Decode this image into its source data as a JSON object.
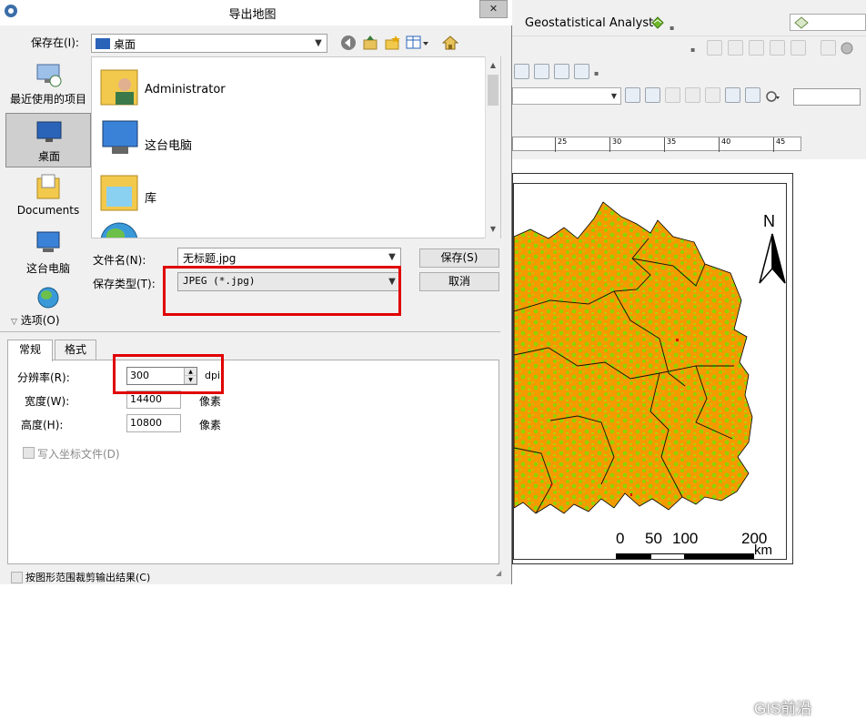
{
  "dialog": {
    "title": "导出地图",
    "close_glyph": "✕",
    "save_in_label": "保存在(I):",
    "save_in_value": "桌面",
    "places": [
      {
        "label": "最近使用的项目"
      },
      {
        "label": "桌面"
      },
      {
        "label": "Documents"
      },
      {
        "label": "这台电脑"
      }
    ],
    "files": [
      {
        "name": "Administrator"
      },
      {
        "name": "这台电脑"
      },
      {
        "name": "库"
      },
      {
        "name": "网络"
      }
    ],
    "filename_label": "文件名(N):",
    "filename_value": "无标题.jpg",
    "filetype_label": "保存类型(T):",
    "filetype_value": "JPEG (*.jpg)",
    "save_button": "保存(S)",
    "cancel_button": "取消",
    "options_label": "选项(O)",
    "tabs": [
      {
        "label": "常规"
      },
      {
        "label": "格式"
      }
    ],
    "resolution_label": "分辨率(R):",
    "resolution_value": "300",
    "resolution_unit": "dpi",
    "width_label": "宽度(W):",
    "width_value": "14400",
    "width_unit": "像素",
    "height_label": "高度(H):",
    "height_value": "10800",
    "height_unit": "像素",
    "world_file_label": "写入坐标文件(D)",
    "clip_label": "按图形范围裁剪输出结果(C)"
  },
  "arcmap": {
    "geostat_label": "Geostatistical Analyst",
    "ruler_ticks": [
      "25",
      "30",
      "35",
      "40",
      "45"
    ],
    "north_label": "N",
    "scale_labels": [
      "0",
      "50",
      "100",
      "200"
    ],
    "scale_unit": "km"
  },
  "watermark": {
    "text": "GIS前沿"
  },
  "colors": {
    "map_orange": "#f59a00",
    "map_green": "#8fd400",
    "highlight_red": "#e00000"
  }
}
